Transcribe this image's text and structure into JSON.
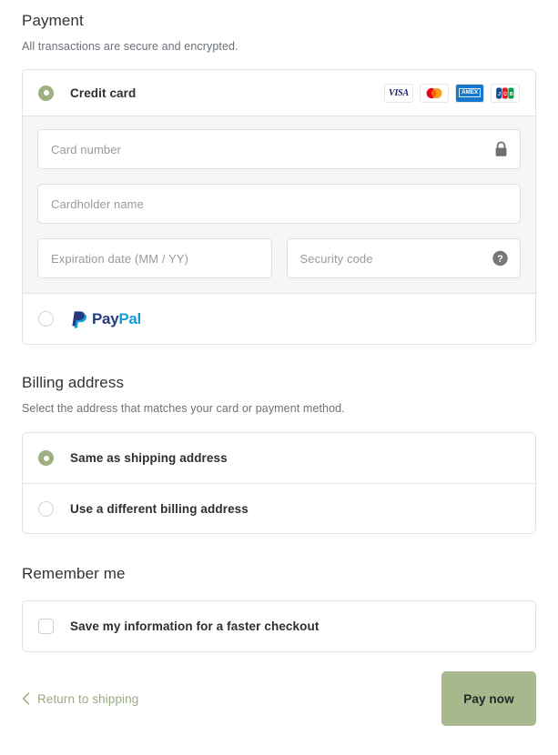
{
  "payment": {
    "title": "Payment",
    "subtitle": "All transactions are secure and encrypted.",
    "methods": [
      {
        "id": "credit-card",
        "label": "Credit card",
        "selected": true
      },
      {
        "id": "paypal",
        "label": "PayPal",
        "selected": false
      }
    ],
    "card_brands": [
      "visa",
      "mastercard",
      "amex",
      "jcb"
    ],
    "fields": {
      "card_number": {
        "placeholder": "Card number",
        "value": "",
        "trailing_icon": "lock-icon"
      },
      "cardholder_name": {
        "placeholder": "Cardholder name",
        "value": ""
      },
      "expiration": {
        "placeholder": "Expiration date (MM / YY)",
        "value": ""
      },
      "security_code": {
        "placeholder": "Security code",
        "value": "",
        "trailing_icon": "help-icon"
      }
    }
  },
  "billing": {
    "title": "Billing address",
    "subtitle": "Select the address that matches your card or payment method.",
    "options": [
      {
        "id": "same-as-shipping",
        "label": "Same as shipping address",
        "selected": true
      },
      {
        "id": "different-billing",
        "label": "Use a different billing address",
        "selected": false
      }
    ]
  },
  "remember": {
    "title": "Remember me",
    "checkbox_label": "Save my information for a faster checkout",
    "checked": false
  },
  "footer": {
    "return_link": "Return to shipping",
    "pay_button": "Pay now"
  },
  "colors": {
    "accent_green": "#a7b88c",
    "radio_green": "#9eb082",
    "link_green": "#9aab86",
    "heading": "#333333",
    "muted_text": "#6b7177",
    "placeholder": "#9a9a9a",
    "border": "#e3e3e3",
    "form_background": "#f6f6f6"
  },
  "brand_text": {
    "visa": "VISA",
    "amex": "AMEX",
    "paypal_pay": "Pay",
    "paypal_pal": "Pal"
  }
}
